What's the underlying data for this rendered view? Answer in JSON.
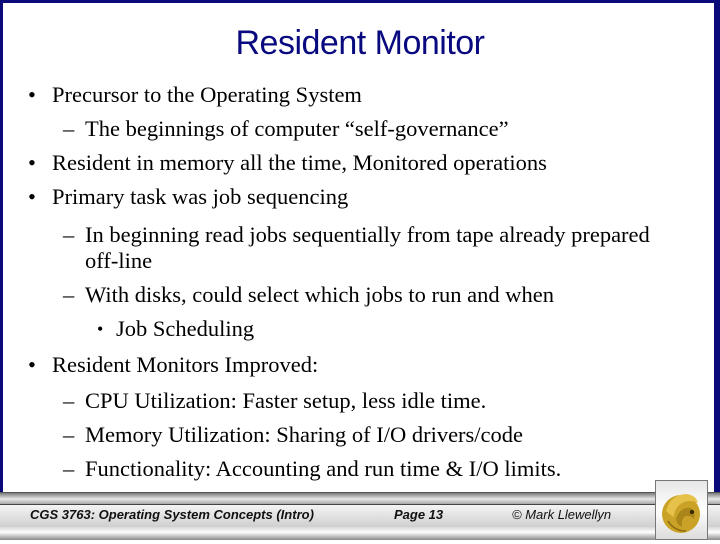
{
  "slide": {
    "title": "Resident Monitor",
    "colors": {
      "title": "#0a0a80",
      "border": "#0a0a7a",
      "logo_gold": "#c9a227"
    },
    "bullets": [
      {
        "level": 1,
        "marker": "•",
        "text": "Precursor to the Operating System"
      },
      {
        "level": 2,
        "marker": "–",
        "text": "The beginnings of computer “self-governance”"
      },
      {
        "level": 1,
        "marker": "•",
        "text": "Resident in memory all the time, Monitored operations"
      },
      {
        "level": 1,
        "marker": "•",
        "text": "Primary task was job sequencing"
      },
      {
        "level": 2,
        "marker": "–",
        "text": "In beginning read jobs sequentially from tape already prepared"
      },
      {
        "level": 2,
        "marker": "",
        "text": "off-line"
      },
      {
        "level": 2,
        "marker": "–",
        "text": "With disks, could select which jobs to run and when"
      },
      {
        "level": 3,
        "marker": "•",
        "text": "Job Scheduling"
      },
      {
        "level": 1,
        "marker": "•",
        "text": "Resident Monitors Improved:"
      },
      {
        "level": 2,
        "marker": "–",
        "text": "CPU Utilization:   Faster setup, less idle time."
      },
      {
        "level": 2,
        "marker": "–",
        "text": "Memory Utilization:  Sharing of I/O drivers/code"
      },
      {
        "level": 2,
        "marker": "–",
        "text": "Functionality:  Accounting and run time & I/O limits."
      }
    ]
  },
  "footer": {
    "course": "CGS 3763: Operating System Concepts  (Intro)",
    "page": "Page 13",
    "copyright": "© Mark Llewellyn",
    "logo_icon": "pegasus-logo-icon"
  }
}
